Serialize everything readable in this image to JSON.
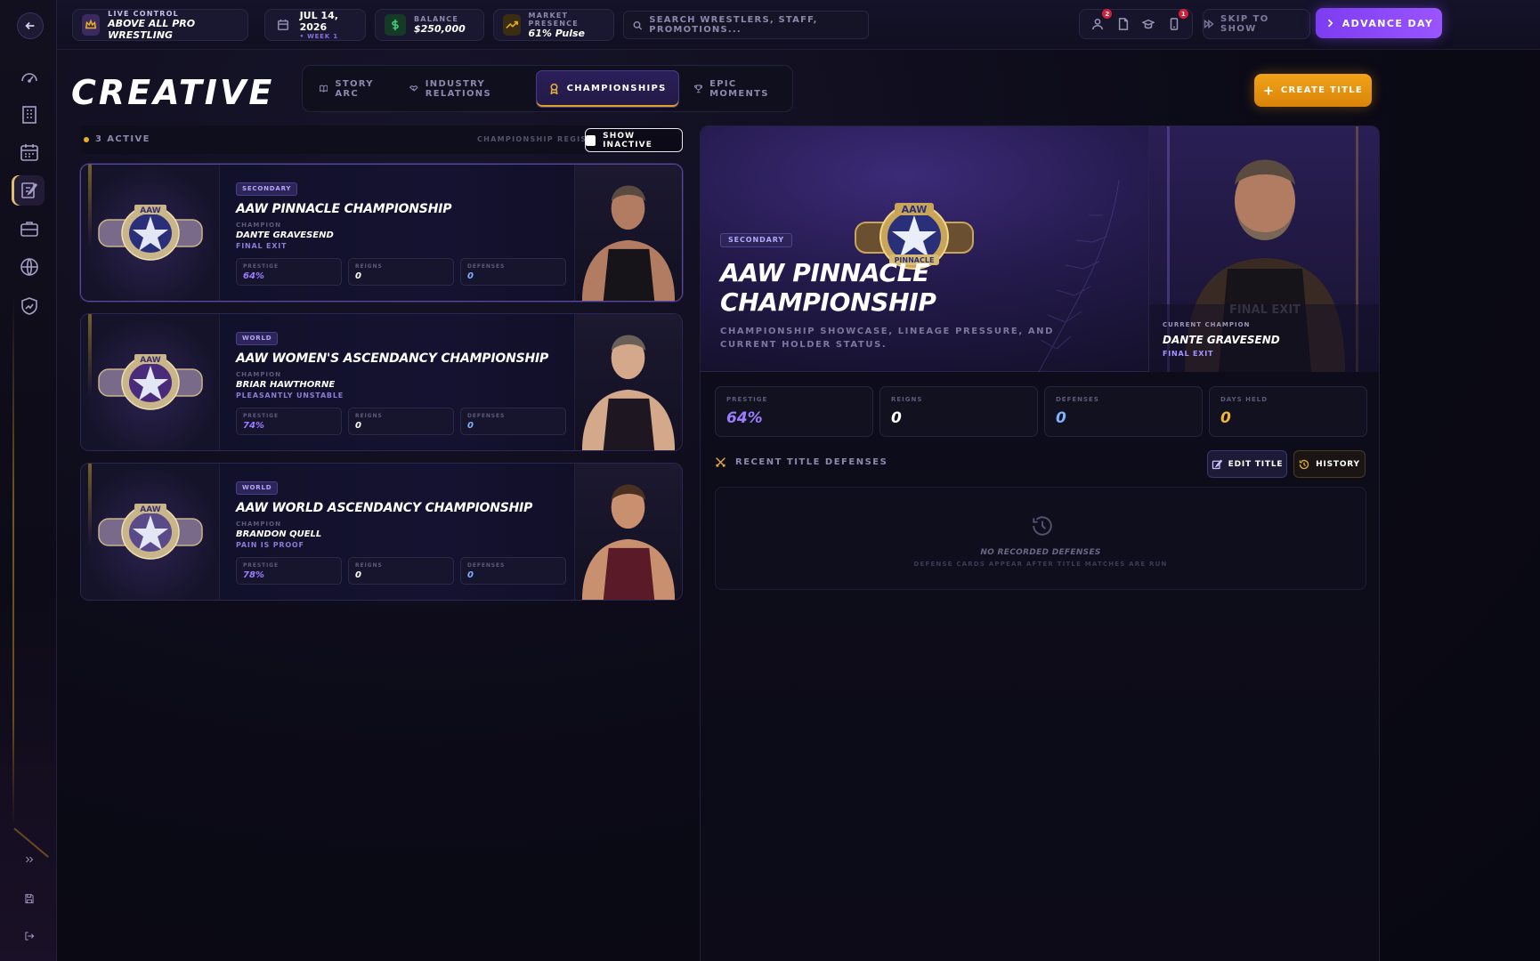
{
  "topbar": {
    "promotion": {
      "label": "LIVE CONTROL",
      "value": "ABOVE ALL PRO WRESTLING"
    },
    "date": {
      "value": "JUL 14, 2026",
      "sub": "• WEEK 1"
    },
    "balance": {
      "label": "BALANCE",
      "value": "$250,000"
    },
    "market": {
      "label": "MARKET PRESENCE",
      "value": "61% Pulse"
    },
    "search_placeholder": "SEARCH WRESTLERS, STAFF, PROMOTIONS...",
    "badges": {
      "roster": "2",
      "inbox": "1"
    },
    "skip_label": "SKIP TO SHOW",
    "advance_label": "ADVANCE DAY"
  },
  "page": {
    "title": "CREATIVE",
    "tabs": [
      {
        "label": "STORY ARC",
        "icon": "book-icon"
      },
      {
        "label": "INDUSTRY RELATIONS",
        "icon": "handshake-icon"
      },
      {
        "label": "CHAMPIONSHIPS",
        "icon": "medal-icon"
      },
      {
        "label": "EPIC MOMENTS",
        "icon": "trophy-icon"
      }
    ],
    "create_label": "CREATE TITLE"
  },
  "registry": {
    "active_count": "3 ACTIVE",
    "label": "CHAMPIONSHIP REGISTRY",
    "show_inactive": "SHOW INACTIVE"
  },
  "titles": [
    {
      "tier": "SECONDARY",
      "name": "AAW PINNACLE CHAMPIONSHIP",
      "champion_label": "CHAMPION",
      "champion": "DANTE GRAVESEND",
      "gimmick": "FINAL EXIT",
      "stats": [
        {
          "label": "PRESTIGE",
          "value": "64%"
        },
        {
          "label": "REIGNS",
          "value": "0"
        },
        {
          "label": "DEFENSES",
          "value": "0"
        }
      ]
    },
    {
      "tier": "WORLD",
      "name": "AAW WOMEN'S ASCENDANCY CHAMPIONSHIP",
      "champion_label": "CHAMPION",
      "champion": "BRIAR HAWTHORNE",
      "gimmick": "PLEASANTLY UNSTABLE",
      "stats": [
        {
          "label": "PRESTIGE",
          "value": "74%"
        },
        {
          "label": "REIGNS",
          "value": "0"
        },
        {
          "label": "DEFENSES",
          "value": "0"
        }
      ]
    },
    {
      "tier": "WORLD",
      "name": "AAW WORLD ASCENDANCY CHAMPIONSHIP",
      "champion_label": "CHAMPION",
      "champion": "BRANDON QUELL",
      "gimmick": "PAIN IS PROOF",
      "stats": [
        {
          "label": "PRESTIGE",
          "value": "78%"
        },
        {
          "label": "REIGNS",
          "value": "0"
        },
        {
          "label": "DEFENSES",
          "value": "0"
        }
      ]
    }
  ],
  "detail": {
    "tier": "SECONDARY",
    "name": "AAW PINNACLE CHAMPIONSHIP",
    "description": "CHAMPIONSHIP SHOWCASE, LINEAGE PRESSURE, AND CURRENT HOLDER STATUS.",
    "current_label": "CURRENT CHAMPION",
    "champion": "DANTE GRAVESEND",
    "gimmick": "FINAL EXIT",
    "stats": [
      {
        "label": "PRESTIGE",
        "value": "64%",
        "color": "#9c7cff"
      },
      {
        "label": "REIGNS",
        "value": "0",
        "color": "#ffffff"
      },
      {
        "label": "DEFENSES",
        "value": "0",
        "color": "#7fb2ff"
      },
      {
        "label": "DAYS HELD",
        "value": "0",
        "color": "#f2b634"
      }
    ],
    "defenses_title": "RECENT TITLE DEFENSES",
    "edit_label": "EDIT TITLE",
    "history_label": "HISTORY",
    "empty_title": "NO RECORDED DEFENSES",
    "empty_sub": "DEFENSE CARDS APPEAR AFTER TITLE MATCHES ARE RUN"
  },
  "colors": {
    "accent_purple": "#8b4cff",
    "accent_gold": "#f2a318",
    "prestige": "#9c7cff",
    "reigns": "#ffffff",
    "defenses": "#7fb2ff"
  }
}
